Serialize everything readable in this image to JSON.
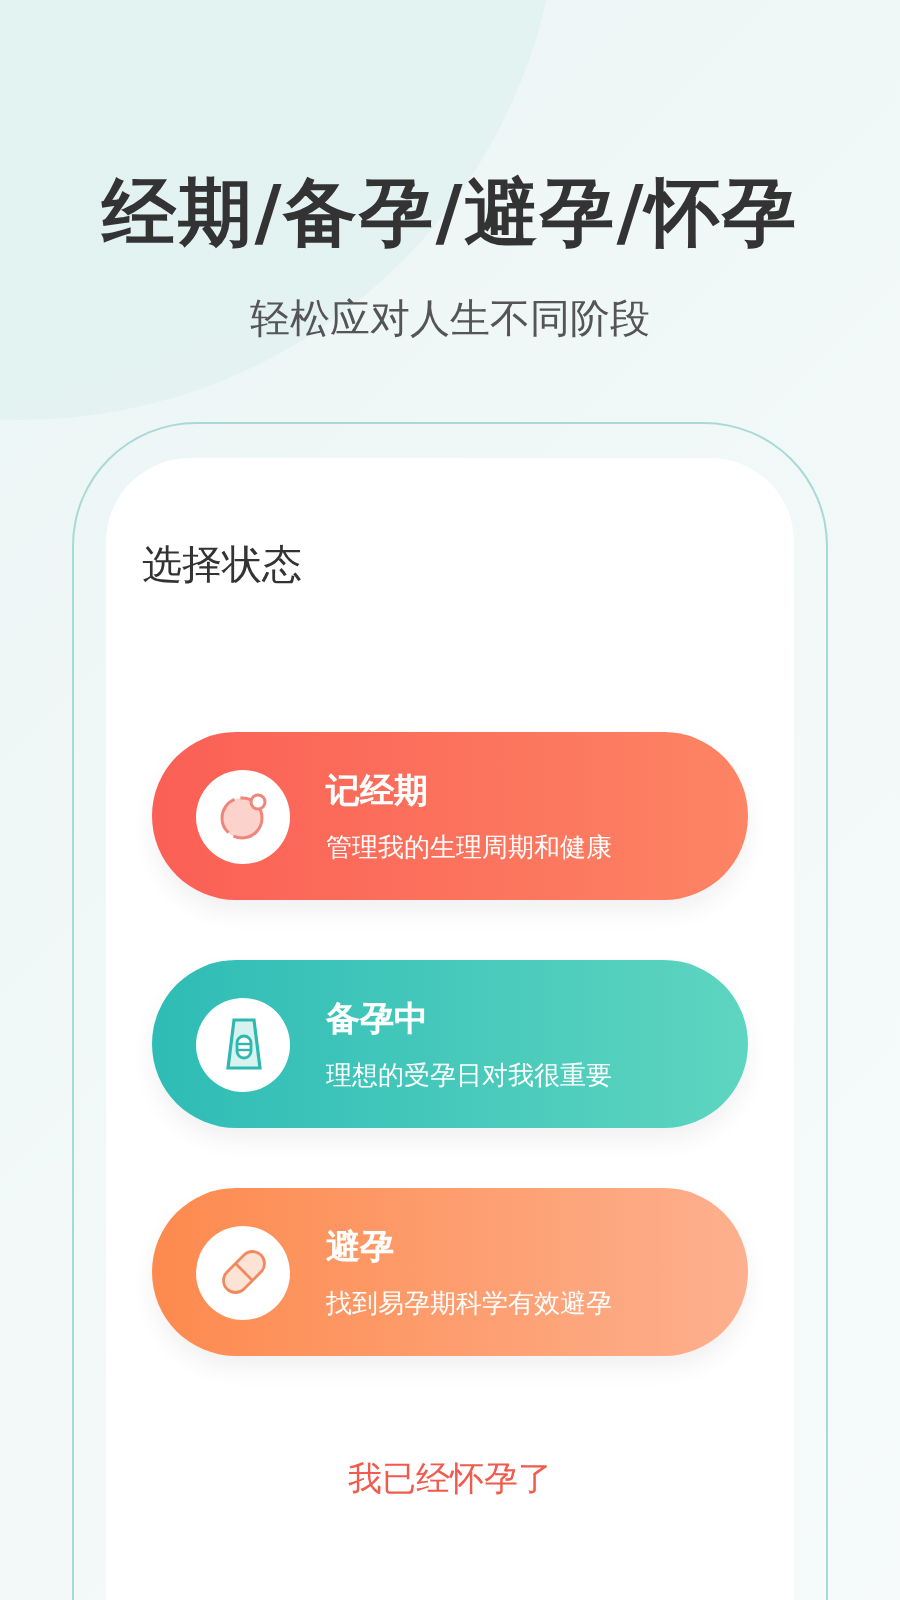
{
  "headline": "经期/备孕/避孕/怀孕",
  "subtitle": "轻松应对人生不同阶段",
  "card": {
    "title": "选择状态",
    "options": [
      {
        "kind": "period",
        "title": "记经期",
        "description": "管理我的生理周期和健康"
      },
      {
        "kind": "trying",
        "title": "备孕中",
        "description": "理想的受孕日对我很重要"
      },
      {
        "kind": "avoid",
        "title": "避孕",
        "description": "找到易孕期科学有效避孕"
      }
    ],
    "link": "我已经怀孕了"
  }
}
